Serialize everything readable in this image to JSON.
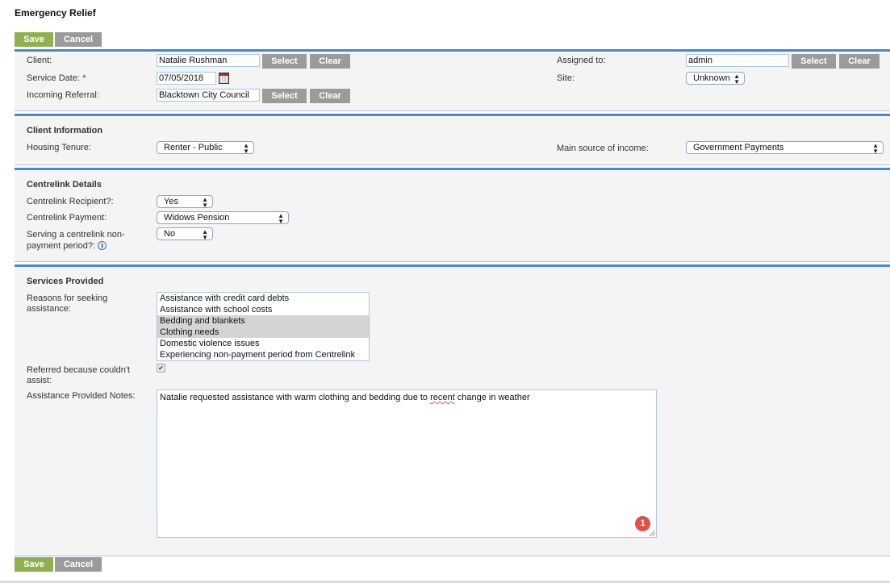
{
  "page": {
    "title": "Emergency Relief"
  },
  "toolbar": {
    "save_label": "Save",
    "cancel_label": "Cancel"
  },
  "general": {
    "client_label": "Client:",
    "client_value": "Natalie Rushman",
    "service_date_label": "Service Date:",
    "required_marker": "*",
    "service_date_value": "07/05/2018",
    "incoming_referral_label": "Incoming Referral:",
    "incoming_referral_value": "Blacktown City Council",
    "assigned_to_label": "Assigned to:",
    "assigned_to_value": "admin",
    "site_label": "Site:",
    "site_value": "Unknown",
    "select_label": "Select",
    "clear_label": "Clear"
  },
  "client_information": {
    "title": "Client Information",
    "housing_tenure_label": "Housing Tenure:",
    "housing_tenure_value": "Renter - Public",
    "income_label": "Main source of income:",
    "income_value": "Government Payments"
  },
  "centrelink": {
    "title": "Centrelink Details",
    "recipient_label": "Centrelink Recipient?:",
    "recipient_value": "Yes",
    "payment_label": "Centrelink Payment:",
    "payment_value": "Widows Pension",
    "non_payment_label_line1": "Serving a centrelink non-",
    "non_payment_label_line2": "payment period?:",
    "non_payment_value": "No",
    "info_icon": "i"
  },
  "services": {
    "title": "Services Provided",
    "reasons_label_line1": "Reasons for seeking",
    "reasons_label_line2": "assistance:",
    "reasons_options": [
      {
        "label": "Assistance with credit card debts",
        "selected": false
      },
      {
        "label": "Assistance with school costs",
        "selected": false
      },
      {
        "label": "Bedding and blankets",
        "selected": true
      },
      {
        "label": "Clothing needs",
        "selected": true
      },
      {
        "label": "Domestic violence issues",
        "selected": false
      },
      {
        "label": "Experiencing non-payment period from Centrelink",
        "selected": false
      }
    ],
    "referred_label_line1": "Referred because couldn't",
    "referred_label_line2": "assist:",
    "referred_checked": true,
    "referred_check_glyph": "✔",
    "notes_label": "Assistance Provided Notes:",
    "notes_before": "Natalie requested assistance with warm clothing and bedding due to ",
    "notes_misspelled": "recent",
    "notes_after": " change in weather",
    "notes_badge": "1"
  },
  "arrows": {
    "up": "▲",
    "down": "▼"
  }
}
